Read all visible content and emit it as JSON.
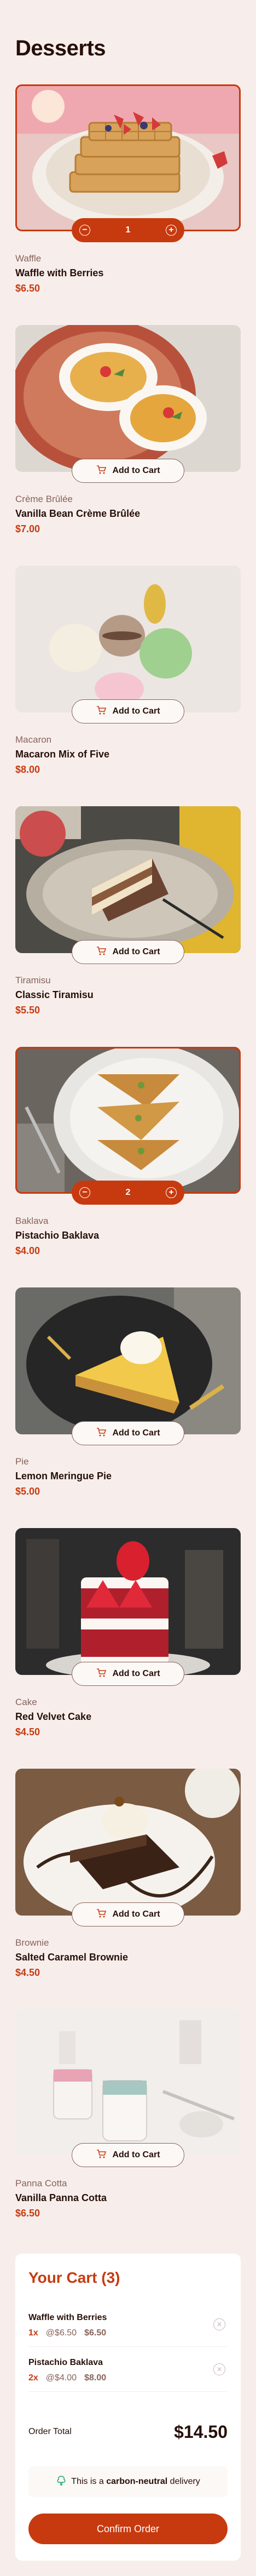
{
  "page": {
    "title": "Desserts"
  },
  "products": [
    {
      "category": "Waffle",
      "name": "Waffle with Berries",
      "price": "$6.50",
      "in_cart": true,
      "quantity": "1",
      "image": "waffle-berries"
    },
    {
      "category": "Crème Brûlée",
      "name": "Vanilla Bean Crème Brûlée",
      "price": "$7.00",
      "in_cart": false,
      "image": "creme-brulee"
    },
    {
      "category": "Macaron",
      "name": "Macaron Mix of Five",
      "price": "$8.00",
      "in_cart": false,
      "image": "macarons"
    },
    {
      "category": "Tiramisu",
      "name": "Classic Tiramisu",
      "price": "$5.50",
      "in_cart": false,
      "image": "tiramisu"
    },
    {
      "category": "Baklava",
      "name": "Pistachio Baklava",
      "price": "$4.00",
      "in_cart": true,
      "quantity": "2",
      "image": "baklava"
    },
    {
      "category": "Pie",
      "name": "Lemon Meringue Pie",
      "price": "$5.00",
      "in_cart": false,
      "image": "lemon-pie"
    },
    {
      "category": "Cake",
      "name": "Red Velvet Cake",
      "price": "$4.50",
      "in_cart": false,
      "image": "red-velvet-cake"
    },
    {
      "category": "Brownie",
      "name": "Salted Caramel Brownie",
      "price": "$4.50",
      "in_cart": false,
      "image": "brownie"
    },
    {
      "category": "Panna Cotta",
      "name": "Vanilla Panna Cotta",
      "price": "$6.50",
      "in_cart": false,
      "image": "panna-cotta"
    }
  ],
  "labels": {
    "add_to_cart": "Add to Cart"
  },
  "icons": {
    "cart": "add-to-cart-icon",
    "decrement": "minus-icon",
    "increment": "plus-icon",
    "remove": "remove-item-icon",
    "carbon": "tree-icon"
  },
  "colors": {
    "accent": "#c73a0f",
    "background": "#f7eeec",
    "text": "#260f08",
    "muted": "#87635a"
  },
  "cart": {
    "title": "Your Cart (3)",
    "items": [
      {
        "name": "Waffle with Berries",
        "qty": "1x",
        "unit": "@$6.50",
        "total": "$6.50"
      },
      {
        "name": "Pistachio Baklava",
        "qty": "2x",
        "unit": "@$4.00",
        "total": "$8.00"
      }
    ],
    "order_total_label": "Order Total",
    "order_total": "$14.50",
    "carbon_pre": "This is a",
    "carbon_bold": "carbon-neutral",
    "carbon_post": "delivery",
    "confirm_label": "Confirm Order"
  }
}
